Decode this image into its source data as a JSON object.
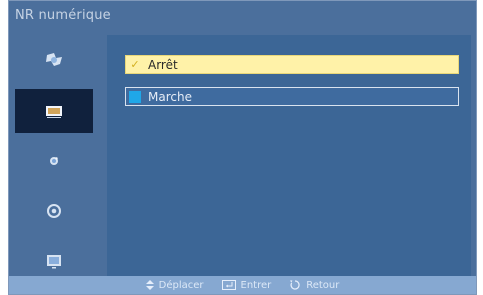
{
  "menu": {
    "title": "NR numérique"
  },
  "sidebar": {
    "items": [
      {
        "icon": "picture-icon",
        "active": false
      },
      {
        "icon": "monitor-icon",
        "active": true
      },
      {
        "icon": "sound-icon",
        "active": false
      },
      {
        "icon": "setup-icon",
        "active": false
      },
      {
        "icon": "input-icon",
        "active": false
      }
    ]
  },
  "options": [
    {
      "label": "Arrêt",
      "selected": true
    },
    {
      "label": "Marche",
      "selected": false
    }
  ],
  "footer": {
    "move_label": "Déplacer",
    "enter_label": "Entrer",
    "return_label": "Retour"
  },
  "colors": {
    "panel": "#4b6f9c",
    "content": "#3c6696",
    "selected_option": "#fff2a8",
    "active_sidebar": "#10213d",
    "footer": "#86a8d1"
  }
}
